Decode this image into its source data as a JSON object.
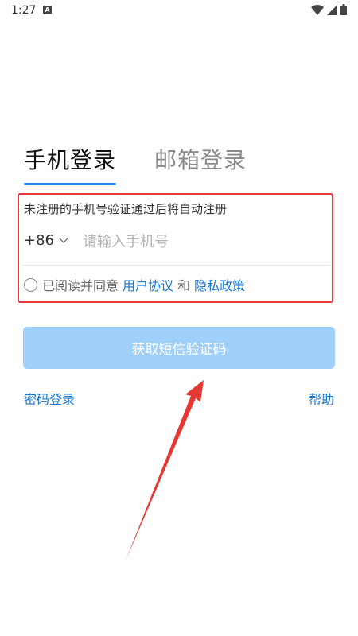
{
  "status_bar": {
    "time": "1:27",
    "app_icon_letter": "A",
    "icons": [
      "wifi-icon",
      "signal-icon",
      "battery-icon"
    ]
  },
  "tabs": [
    {
      "label": "手机登录",
      "active": true
    },
    {
      "label": "邮箱登录",
      "active": false
    }
  ],
  "form": {
    "hint": "未注册的手机号验证通过后将自动注册",
    "country_code": "+86",
    "phone_placeholder": "请输入手机号",
    "phone_value": "",
    "agreement_prefix": "已阅读并同意",
    "agreement_link_user": "用户协议",
    "agreement_and": "和",
    "agreement_link_privacy": "隐私政策",
    "agreement_checked": false
  },
  "actions": {
    "get_code_label": "获取短信验证码",
    "password_login_label": "密码登录",
    "help_label": "帮助"
  },
  "colors": {
    "accent": "#1976d2",
    "button_disabled": "#9fd0fb",
    "annotation": "#e53935"
  }
}
